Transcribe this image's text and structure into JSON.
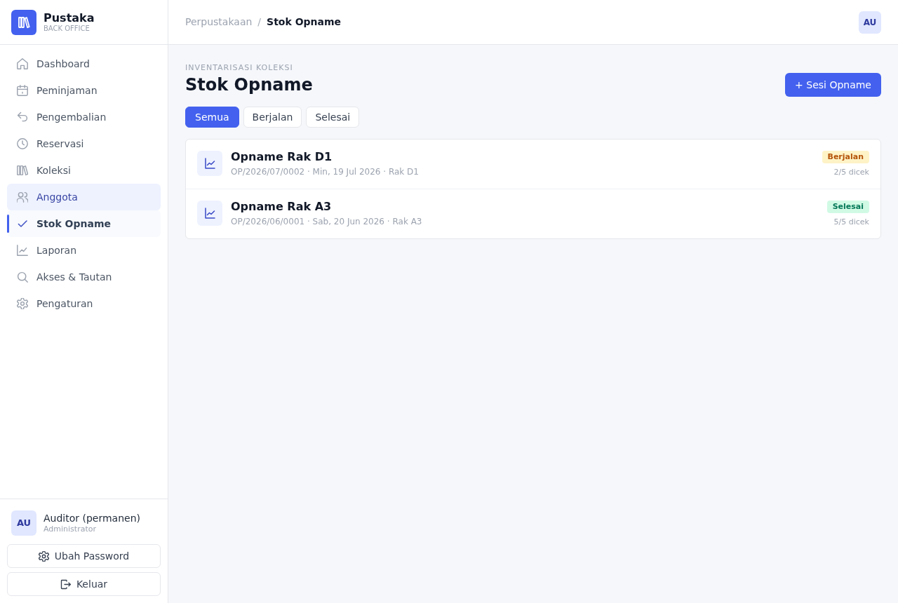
{
  "sidebar": {
    "brand": {
      "name": "Pustaka",
      "subtitle": "BACK OFFICE"
    },
    "nav": [
      {
        "label": "Dashboard",
        "selected": false,
        "hovered": false
      },
      {
        "label": "Peminjaman",
        "selected": false,
        "hovered": false
      },
      {
        "label": "Pengembalian",
        "selected": false,
        "hovered": false
      },
      {
        "label": "Reservasi",
        "selected": false,
        "hovered": false
      },
      {
        "label": "Koleksi",
        "selected": false,
        "hovered": false
      },
      {
        "label": "Anggota",
        "selected": false,
        "hovered": true
      },
      {
        "label": "Stok Opname",
        "selected": true,
        "hovered": false
      },
      {
        "label": "Laporan",
        "selected": false,
        "hovered": false
      },
      {
        "label": "Akses & Tautan",
        "selected": false,
        "hovered": false
      },
      {
        "label": "Pengaturan",
        "selected": false,
        "hovered": false
      }
    ],
    "user": {
      "initials": "AU",
      "name": "Auditor (permanen)",
      "role": "Administrator"
    },
    "buttons": [
      {
        "label": "Ubah Password"
      },
      {
        "label": "Keluar"
      }
    ]
  },
  "header": {
    "breadcrumb": [
      {
        "label": "Perpustakaan",
        "current": false
      },
      {
        "label": "Stok Opname",
        "current": true
      }
    ],
    "separator": "/",
    "avatar": "AU"
  },
  "page": {
    "eyebrow": "INVENTARISASI KOLEKSI",
    "title": "Stok Opname",
    "action": "+ Sesi Opname",
    "filters": [
      {
        "label": "Semua",
        "selected": true
      },
      {
        "label": "Berjalan",
        "selected": false
      },
      {
        "label": "Selesai",
        "selected": false
      }
    ],
    "sessions": [
      {
        "title": "Opname Rak D1",
        "meta": "OP/2026/07/0002 · Min, 19 Jul 2026 · Rak D1",
        "status": {
          "label": "Berjalan",
          "kind": "running"
        },
        "progress": "2/5 dicek"
      },
      {
        "title": "Opname Rak A3",
        "meta": "OP/2026/06/0001 · Sab, 20 Jun 2026 · Rak A3",
        "status": {
          "label": "Selesai",
          "kind": "done"
        },
        "progress": "5/5 dicek"
      }
    ]
  }
}
